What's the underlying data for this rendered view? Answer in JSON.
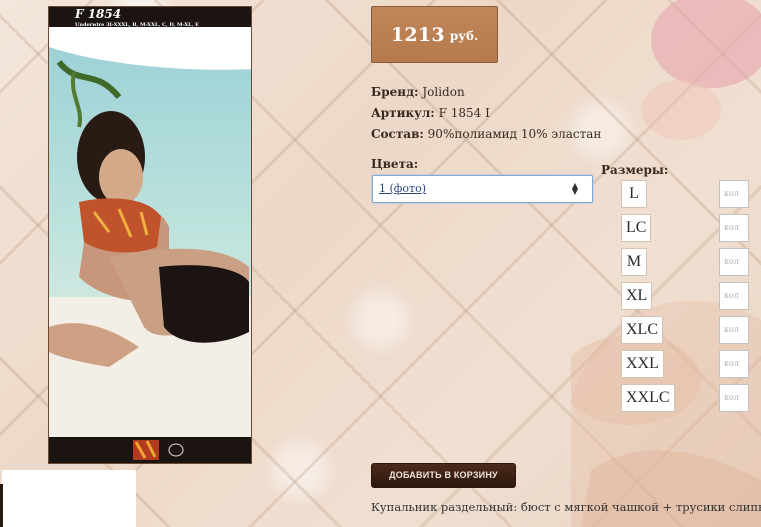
{
  "product": {
    "photo_code": "F 1854",
    "photo_sizes": "Underwire 3I-XXXL, B, M-XXL, C, D, M-XL, E",
    "price_value": "1213",
    "price_currency": "руб.",
    "attributes": [
      {
        "label": "Бренд:",
        "value": "Jolidon"
      },
      {
        "label": "Артикул:",
        "value": "F 1854 I"
      },
      {
        "label": "Состав:",
        "value": "90%полиамид 10% эластан"
      }
    ],
    "colors_label": "Цвета:",
    "color_selected": "1 (фото)",
    "sizes_label": "Размеры:",
    "sizes": [
      {
        "label": "L",
        "qty_placeholder": "кол"
      },
      {
        "label": "LC",
        "qty_placeholder": "кол"
      },
      {
        "label": "M",
        "qty_placeholder": "кол"
      },
      {
        "label": "XL",
        "qty_placeholder": "кол"
      },
      {
        "label": "XLC",
        "qty_placeholder": "кол"
      },
      {
        "label": "XXL",
        "qty_placeholder": "кол"
      },
      {
        "label": "XXLC",
        "qty_placeholder": "кол"
      }
    ],
    "add_to_cart": "ДОБАВИТЬ В КОРЗИНУ",
    "description": "Купальник раздельный: бюст с мягкой чашкой + трусики слипы."
  }
}
